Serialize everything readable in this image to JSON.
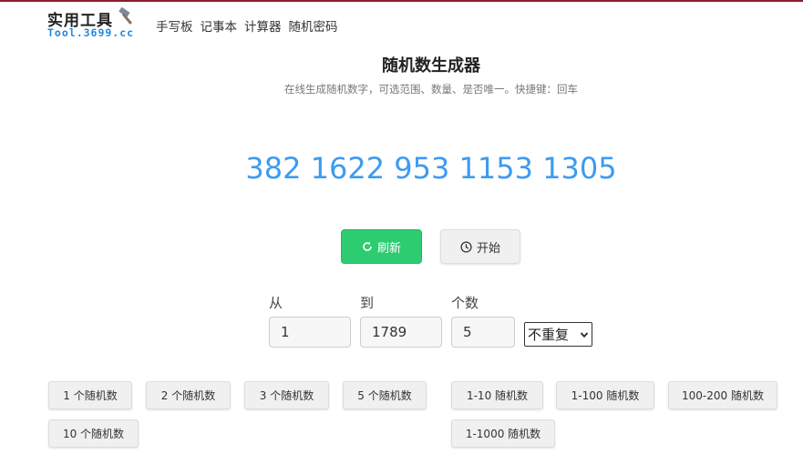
{
  "logo": {
    "title": "实用工具",
    "subtitle": "Tool.3699.cc",
    "icon": "hammer-icon"
  },
  "nav": [
    "手写板",
    "记事本",
    "计算器",
    "随机密码"
  ],
  "page": {
    "title": "随机数生成器",
    "description": "在线生成随机数字，可选范围、数量、是否唯一。快捷键：回车"
  },
  "result": "382 1622 953 1153 1305",
  "buttons": {
    "refresh": "刷新",
    "start": "开始",
    "refresh_icon": "refresh-icon",
    "start_icon": "clock-icon"
  },
  "form": {
    "from_label": "从",
    "from_value": "1",
    "to_label": "到",
    "to_value": "1789",
    "count_label": "个数",
    "count_value": "5",
    "unique_selected": "不重复"
  },
  "quick_count": [
    "1 个随机数",
    "2 个随机数",
    "3 个随机数",
    "5 个随机数",
    "10 个随机数"
  ],
  "quick_range": [
    "1-10 随机数",
    "1-100 随机数",
    "100-200 随机数",
    "1-1000 随机数"
  ],
  "colors": {
    "accent_blue": "#3d9bf0",
    "refresh_green": "#2ecc71",
    "top_border": "#8b1d2c"
  }
}
